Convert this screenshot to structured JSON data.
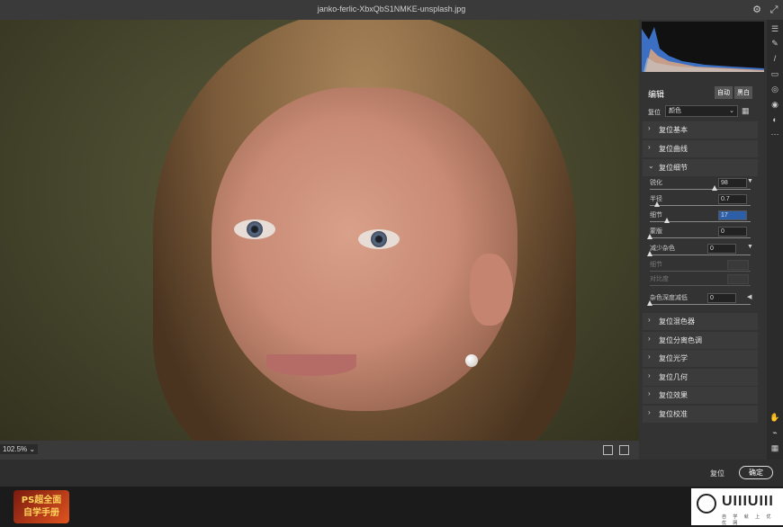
{
  "window": {
    "title": "janko-ferlic-XbxQbS1NMKE-unsplash.jpg"
  },
  "preview": {
    "zoom": "102.5%"
  },
  "panel": {
    "header": "编辑",
    "auto": "自动",
    "bw": "黑白",
    "profile_label": "复位",
    "profile_value": "颜色",
    "sections": [
      {
        "label": "复位基本",
        "open": false
      },
      {
        "label": "复位曲线",
        "open": false
      },
      {
        "label": "复位细节",
        "open": true
      },
      {
        "label": "复位混色器",
        "open": false
      },
      {
        "label": "复位分离色调",
        "open": false
      },
      {
        "label": "复位光学",
        "open": false
      },
      {
        "label": "复位几何",
        "open": false
      },
      {
        "label": "复位效果",
        "open": false
      },
      {
        "label": "复位校准",
        "open": false
      }
    ],
    "detail": {
      "sharpen": {
        "label": "锐化",
        "value": "98"
      },
      "radius": {
        "label": "半径",
        "value": "0.7"
      },
      "detail": {
        "label": "细节",
        "value": "17"
      },
      "mask": {
        "label": "蒙版",
        "value": "0"
      },
      "noise": {
        "label": "减少杂色",
        "value": "0"
      },
      "noise_detail": {
        "label": "细节"
      },
      "noise_contrast": {
        "label": "对比度"
      },
      "color_noise": {
        "label": "杂色深度减低",
        "value": "0"
      }
    }
  },
  "footer": {
    "reset": "复位",
    "ok": "确定",
    "promo_line1": "PS超全面",
    "promo_line2": "自学手册",
    "brand": "UIIIUIII",
    "brand_sub": "自 学 就 上 优 优 网"
  }
}
